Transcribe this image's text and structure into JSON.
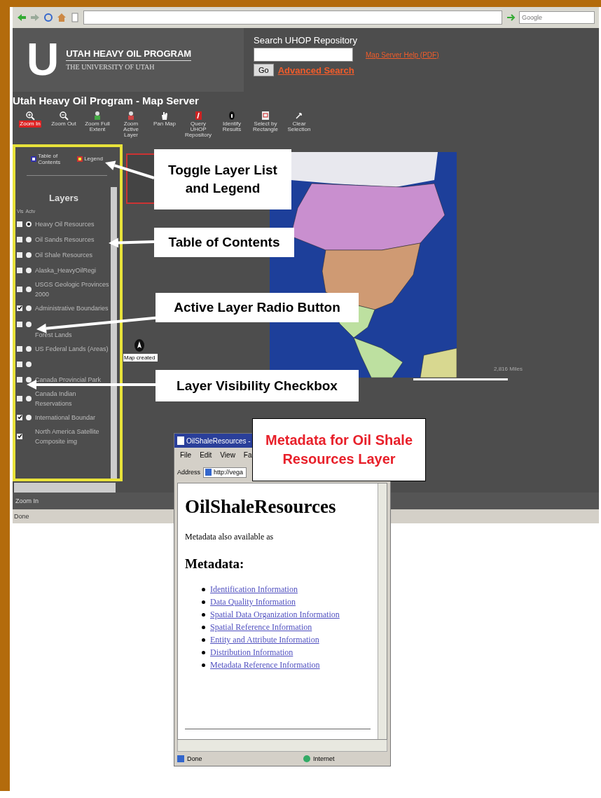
{
  "browser_toolbar": {
    "search_placeholder": "Google"
  },
  "header": {
    "logo_letter": "U",
    "program_name": "UTAH HEAVY OIL PROGRAM",
    "university": "THE UNIVERSITY OF UTAH",
    "search_label": "Search UHOP Repository",
    "go_button": "Go",
    "advanced_search_link": "Advanced Search",
    "help_link": "Map Server Help (PDF)"
  },
  "page_title": "Utah Heavy Oil Program - Map Server",
  "tools": [
    {
      "label": "Zoom In",
      "selected": true
    },
    {
      "label": "Zoom Out",
      "selected": false
    },
    {
      "label": "Zoom Full Extent",
      "selected": false
    },
    {
      "label": "Zoom Active Layer",
      "selected": false
    },
    {
      "label": "Pan Map",
      "selected": false
    },
    {
      "label": "Query UHOP Repository",
      "selected": false
    },
    {
      "label": "Identify Results",
      "selected": false
    },
    {
      "label": "Select by Rectangle",
      "selected": false
    },
    {
      "label": "Clear Selection",
      "selected": false
    }
  ],
  "layer_panel": {
    "tabs": [
      "Table of Contents",
      "Legend"
    ],
    "heading": "Layers",
    "column_labels": [
      "Vis",
      "Actv"
    ],
    "layers": [
      {
        "name": "Heavy Oil Resources",
        "kind": "feature",
        "visible": false,
        "selected": true
      },
      {
        "name": "Oil Sands Resources",
        "kind": "feature",
        "visible": false,
        "selected": false
      },
      {
        "name": "Oil Shale Resources",
        "kind": "feature",
        "visible": false,
        "selected": false
      },
      {
        "name": "Alaska_HeavyOilRegi",
        "kind": "feature",
        "visible": false,
        "selected": false
      },
      {
        "name": "USGS Geologic Provinces 2000",
        "kind": "feature",
        "visible": false,
        "selected": false
      },
      {
        "name": "Administrative Boundaries",
        "kind": "feature",
        "visible": true,
        "selected": false
      },
      {
        "name": "Forest Lands",
        "kind": "feature",
        "visible": false,
        "selected": false
      },
      {
        "name": "US Federal Lands (Areas)",
        "kind": "feature",
        "visible": false,
        "selected": false
      },
      {
        "kind": "feature",
        "visible": false,
        "selected": false
      },
      {
        "name": "Canada Provincial Park",
        "kind": "feature",
        "visible": false,
        "selected": false
      },
      {
        "name": "Canada Indian Reservations",
        "kind": "feature",
        "visible": false,
        "selected": false
      },
      {
        "name": "International Boundar",
        "kind": "feature",
        "visible": true,
        "selected": false
      },
      {
        "name": "North America Satellite Composite img",
        "kind": "raster",
        "visible": true
      }
    ]
  },
  "map": {
    "credit": "Map created",
    "scale_label": "2,816 Miles"
  },
  "status_text": "Zoom In",
  "browser_status": "Done",
  "callouts": [
    {
      "kind": "pointer",
      "text": "Toggle Layer List and Legend"
    },
    {
      "kind": "pointer",
      "text": "Table of Contents"
    },
    {
      "kind": "pointer",
      "text": "Active Layer Radio Button"
    },
    {
      "kind": "pointer",
      "text": "Layer Visibility Checkbox"
    },
    {
      "kind": "caption",
      "text": "Metadata for Oil Shale Resources Layer"
    }
  ],
  "metadata_window": {
    "title": "OilShaleResources -",
    "menu": [
      "File",
      "Edit",
      "View",
      "Fa"
    ],
    "address_label": "Address",
    "address": "http://vega",
    "heading": "OilShaleResources",
    "intro": "Metadata also available as",
    "section_heading": "Metadata:",
    "links": [
      "Identification Information",
      "Data Quality Information",
      "Spatial Data Organization Information",
      "Spatial Reference Information",
      "Entity and Attribute Information",
      "Distribution Information",
      "Metadata Reference Information"
    ],
    "status": "Done",
    "zone": "Internet"
  }
}
